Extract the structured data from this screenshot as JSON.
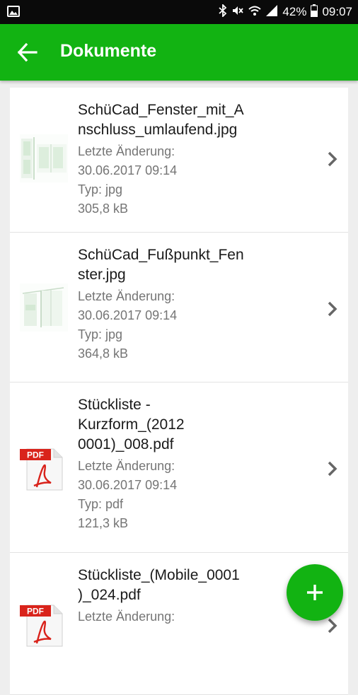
{
  "status_bar": {
    "battery": "42%",
    "time": "09:07"
  },
  "app_bar": {
    "title": "Dokumente"
  },
  "documents": [
    {
      "name_line1": "SchüCad_Fenster_mit_A",
      "name_line2": "nschluss_umlaufend.jpg",
      "name_line3": "",
      "modified_label": "Letzte Änderung:",
      "modified": "30.06.2017 09:14",
      "type": "Typ: jpg",
      "size": "305,8 kB",
      "icon": "image-thumbnail"
    },
    {
      "name_line1": "SchüCad_Fußpunkt_Fen",
      "name_line2": "ster.jpg",
      "name_line3": "",
      "modified_label": "Letzte Änderung:",
      "modified": "30.06.2017 09:14",
      "type": "Typ: jpg",
      "size": "364,8 kB",
      "icon": "image-thumbnail"
    },
    {
      "name_line1": "Stückliste -",
      "name_line2": "Kurzform_(2012",
      "name_line3": "0001)_008.pdf",
      "modified_label": "Letzte Änderung:",
      "modified": "30.06.2017 09:14",
      "type": "Typ: pdf",
      "size": "121,3 kB",
      "icon": "pdf-icon"
    },
    {
      "name_line1": "Stückliste_(Mobile_0001",
      "name_line2": ")_024.pdf",
      "name_line3": "",
      "modified_label": "Letzte Änderung:",
      "modified": "",
      "type": "",
      "size": "",
      "icon": "pdf-icon"
    }
  ],
  "pdf_badge": "PDF",
  "colors": {
    "primary": "#12b312",
    "status_bar": "#0a0a0a",
    "background": "#eeeeee"
  }
}
